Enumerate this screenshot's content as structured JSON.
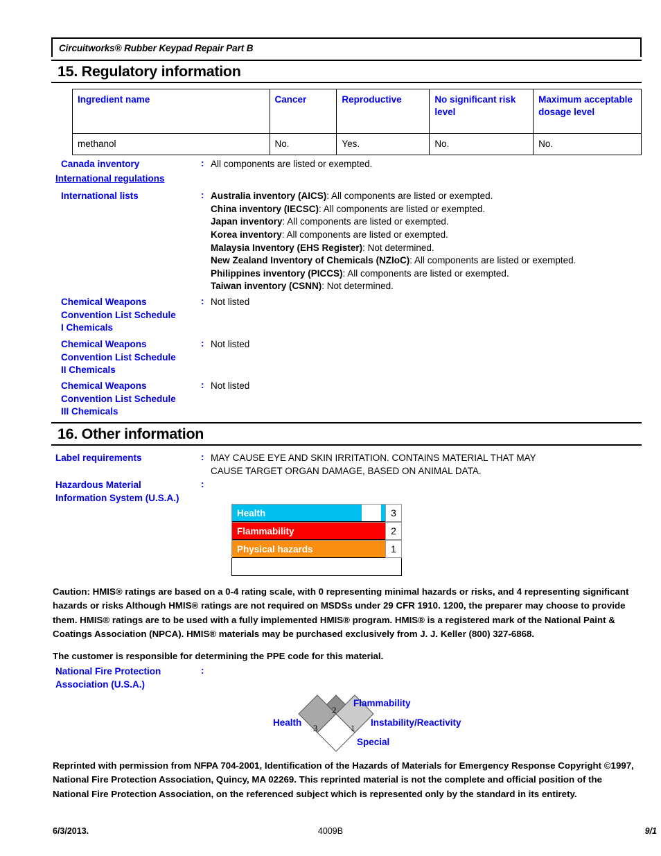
{
  "document": {
    "running_header": "Circuitworks® Rubber Keypad Repair Part B"
  },
  "section15": {
    "title": "15. Regulatory information",
    "table": {
      "headers": [
        "Ingredient name",
        "Cancer",
        "Reproductive",
        "No significant risk level",
        "Maximum acceptable dosage level"
      ],
      "rows": [
        [
          "methanol",
          "No.",
          "Yes.",
          "No.",
          "No."
        ]
      ]
    },
    "canada_inventory": {
      "label": "Canada inventory",
      "colon": ":",
      "value": "All components are listed or exempted."
    },
    "international_regulations_heading": "International regulations",
    "international_lists": {
      "label": "International lists",
      "colon": ":",
      "entries": [
        {
          "name": "Australia inventory (AICS)",
          "value": ": All components are listed or exempted."
        },
        {
          "name": "China inventory (IECSC)",
          "value": ": All components are listed or exempted."
        },
        {
          "name": "Japan inventory",
          "value": ": All components are listed or exempted."
        },
        {
          "name": "Korea inventory",
          "value": ": All components are listed or exempted."
        },
        {
          "name": "Malaysia Inventory (EHS Register)",
          "value": ": Not determined."
        },
        {
          "name": "New Zealand Inventory of Chemicals (NZIoC)",
          "value": ": All components are listed or exempted."
        },
        {
          "name": "Philippines inventory (PICCS)",
          "value": ": All components are listed or exempted."
        },
        {
          "name": "Taiwan inventory (CSNN)",
          "value": ": Not determined."
        }
      ]
    },
    "cwc_schedule_i": {
      "label_line1": "Chemical Weapons",
      "label_line2": "Convention List Schedule",
      "label_line3": "I Chemicals",
      "colon": ":",
      "value": "Not listed"
    },
    "cwc_schedule_ii": {
      "label_line1": "Chemical Weapons",
      "label_line2": "Convention List Schedule",
      "label_line3": "II Chemicals",
      "colon": ":",
      "value": "Not listed"
    },
    "cwc_schedule_iii": {
      "label_line1": "Chemical Weapons",
      "label_line2": "Convention List Schedule",
      "label_line3": "III Chemicals",
      "colon": ":",
      "value": "Not listed"
    }
  },
  "section16": {
    "title": "16. Other information",
    "label_requirements": {
      "label": "Label requirements",
      "colon": ":",
      "line1": "MAY CAUSE EYE AND SKIN IRRITATION.  CONTAINS MATERIAL THAT MAY",
      "line2": "CAUSE TARGET ORGAN DAMAGE, BASED ON ANIMAL DATA."
    },
    "hmis": {
      "label_line1": "Hazardous Material",
      "label_line2": "Information System (U.S.A.)",
      "colon": ":",
      "rows": [
        {
          "name": "Health",
          "rating": "3",
          "color": "#00c0f0"
        },
        {
          "name": "Flammability",
          "rating": "2",
          "color": "#fe0000"
        },
        {
          "name": "Physical hazards",
          "rating": "1",
          "color": "#f98e10"
        }
      ]
    },
    "caution_paragraph": "Caution: HMIS® ratings are based on a 0-4 rating scale, with 0 representing minimal hazards or risks, and 4 representing significant hazards or risks Although HMIS® ratings are not required on MSDSs under 29 CFR 1910. 1200, the preparer may choose to provide them. HMIS® ratings are to be used with a fully implemented HMIS® program. HMIS® is a registered mark of the National Paint & Coatings Association (NPCA). HMIS® materials may be purchased exclusively from J. J. Keller (800) 327-6868.",
    "ppe_paragraph": "The customer is responsible for determining the PPE code for this material.",
    "nfpa": {
      "label_line1": "National Fire Protection",
      "label_line2": "Association (U.S.A.)",
      "colon": ":",
      "health_label": "Health",
      "health_value": "3",
      "flammability_label": "Flammability",
      "flammability_value": "2",
      "instability_label": "Instability/Reactivity",
      "instability_value": "1",
      "special_label": "Special",
      "special_value": "",
      "colors": {
        "health": "#a8a8a8",
        "flammability": "#8c8c8c",
        "instability": "#cccccc",
        "special": "#ffffff"
      }
    },
    "nfpa_reprint_paragraph": "Reprinted with permission from NFPA 704-2001, Identification of the Hazards of Materials for Emergency Response Copyright ©1997, National Fire Protection Association, Quincy, MA 02269. This reprinted material is not the complete and official position of the National Fire Protection Association, on the referenced subject which is represented only by the standard in its entirety."
  },
  "footer": {
    "date": "6/3/2013.",
    "product_code": "4009B",
    "page": "9/1"
  }
}
